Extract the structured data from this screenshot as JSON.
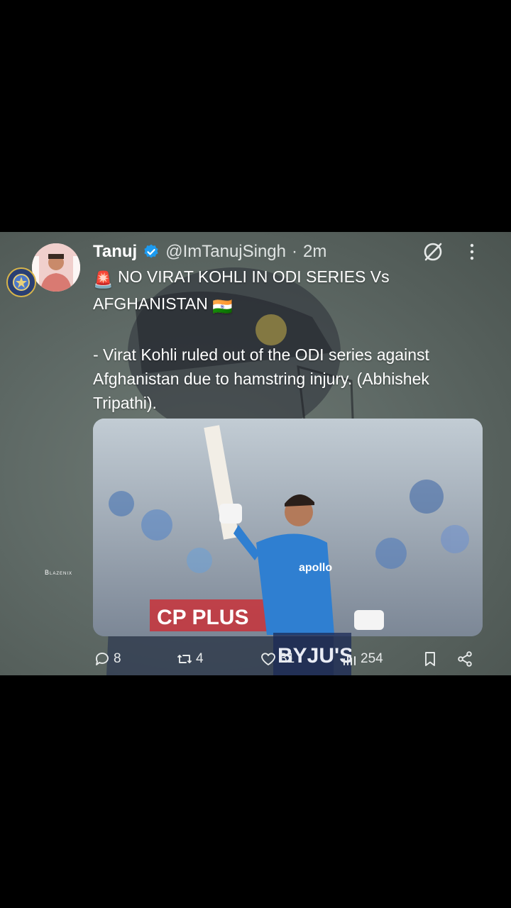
{
  "tweet": {
    "author_name": "Tanuj",
    "handle": "@ImTanujSingh",
    "separator": "·",
    "time": "2m",
    "line1": "NO VIRAT KOHLI IN ODI SERIES Vs",
    "line2": "AFGHANISTAN",
    "body": "- Virat Kohli ruled out of the ODI series against Afghanistan due to hamstring injury. (Abhishek Tripathi).",
    "emoji_alert": "🚨",
    "emoji_flag": "🇮🇳"
  },
  "media": {
    "jersey_text": "apollo",
    "board_text": "CP PLUS",
    "sleeve_text": "BYJU'S"
  },
  "watermark": "Blazenix",
  "actions": {
    "replies": "8",
    "reposts": "4",
    "likes": "31",
    "views": "254"
  },
  "colors": {
    "verified": "#1d9bf0",
    "card_bg": "#5f6a66",
    "text": "#ffffff"
  },
  "icons": [
    "grok-icon",
    "more-icon",
    "verified-badge-icon",
    "reply-icon",
    "repost-icon",
    "like-icon",
    "views-icon",
    "bookmark-icon",
    "share-icon"
  ]
}
